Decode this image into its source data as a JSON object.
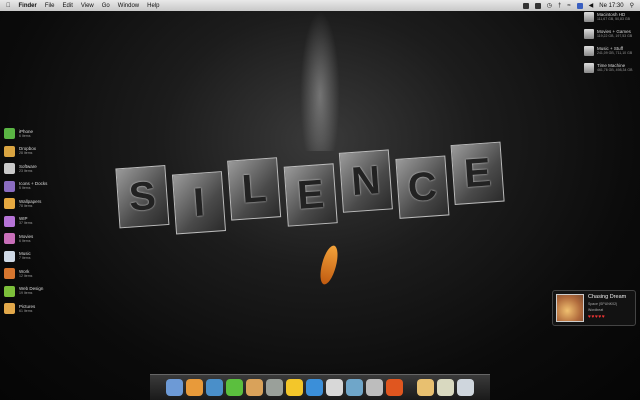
{
  "menubar": {
    "app": "Finder",
    "items": [
      "File",
      "Edit",
      "View",
      "Go",
      "Window",
      "Help"
    ],
    "clock": "Ne 17:30"
  },
  "wallpaper": {
    "art_text": [
      "S",
      "I",
      "L",
      "E",
      "N",
      "C",
      "E"
    ]
  },
  "sidebar": {
    "items": [
      {
        "label": "iPhone",
        "count": "6 Items",
        "color": "#5ab544"
      },
      {
        "label": "Dropbox",
        "count": "28 Items",
        "color": "#d9a441"
      },
      {
        "label": "Software",
        "count": "23 Items",
        "color": "#c9c9c9"
      },
      {
        "label": "Icons + Docks",
        "count": "5 Items",
        "color": "#8a6cc0"
      },
      {
        "label": "Wallpapers",
        "count": "78 Items",
        "color": "#e6a940"
      },
      {
        "label": "WIP",
        "count": "37 Items",
        "color": "#b573d6"
      },
      {
        "label": "Movies",
        "count": "6 Items",
        "color": "#c86fb9"
      },
      {
        "label": "Music",
        "count": "7 Items",
        "color": "#cfd9e6"
      },
      {
        "label": "Work",
        "count": "12 Items",
        "color": "#d7762f"
      },
      {
        "label": "Web Design",
        "count": "19 Items",
        "color": "#7cbf3a"
      },
      {
        "label": "Pictures",
        "count": "61 Items",
        "color": "#e2a84a"
      }
    ]
  },
  "drives": [
    {
      "name": "Macintosh HD",
      "size": "111,67 GB, 50,83 GB"
    },
    {
      "name": "Movies + Games",
      "size": "119,22 GB, 197,53 GB"
    },
    {
      "name": "Music + Stuff",
      "size": "241,09 GB, 711,10 GB"
    },
    {
      "name": "Time Machine",
      "size": "461,76 GB, 498,34 GB"
    }
  ],
  "music_widget": {
    "title": "Chasing Dream",
    "artist": "Space (SPUNK02)",
    "album": "Wordbeat",
    "rating": "♥♥♥♥♥"
  },
  "dock": {
    "items": [
      {
        "name": "finder",
        "color": "#6d9ad6"
      },
      {
        "name": "notes",
        "color": "#e89a3a"
      },
      {
        "name": "safari",
        "color": "#4a8fc9"
      },
      {
        "name": "facetime",
        "color": "#5bbf3e"
      },
      {
        "name": "twitter",
        "color": "#d9a25a"
      },
      {
        "name": "itunes",
        "color": "#9aa09a"
      },
      {
        "name": "cyberduck",
        "color": "#f3c62a"
      },
      {
        "name": "feather",
        "color": "#3b8fd9"
      },
      {
        "name": "textedit",
        "color": "#d8d8d8"
      },
      {
        "name": "preview",
        "color": "#6fa6c9"
      },
      {
        "name": "system-preferences",
        "color": "#bdbdbd"
      },
      {
        "name": "firefox",
        "color": "#e0561f"
      }
    ],
    "right_items": [
      {
        "name": "downloads",
        "color": "#e8c070"
      },
      {
        "name": "documents",
        "color": "#d9d9c0"
      },
      {
        "name": "trash",
        "color": "#cfd6dd"
      }
    ]
  }
}
